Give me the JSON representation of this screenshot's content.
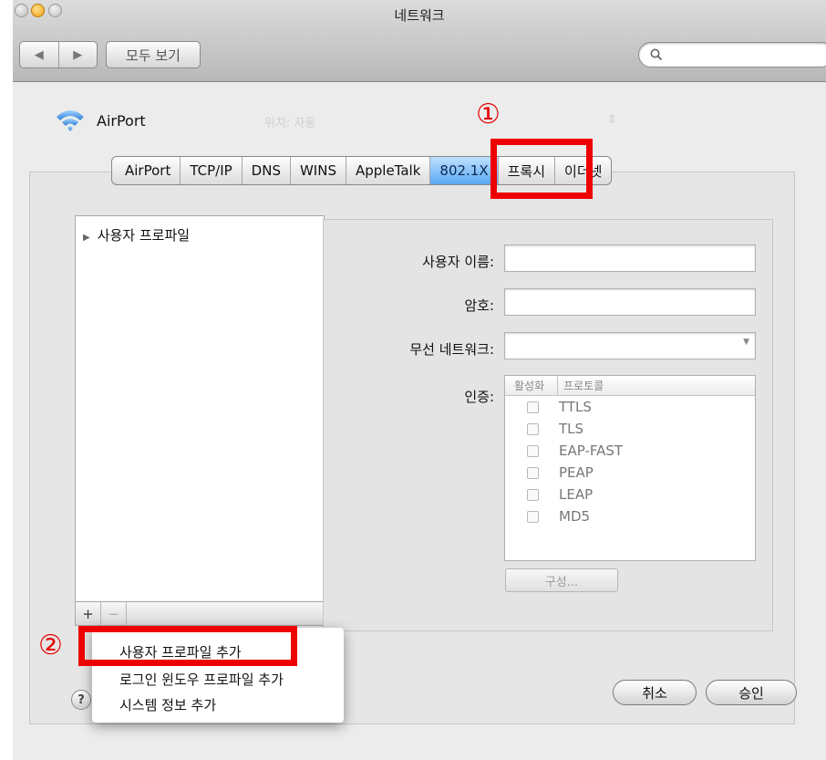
{
  "window": {
    "title": "네트워크",
    "nav_back": "◀",
    "nav_forward": "▶",
    "show_all": "모두 보기",
    "search_placeholder": ""
  },
  "header": {
    "service_name": "AirPort"
  },
  "tabs": [
    {
      "label": "AirPort",
      "active": false
    },
    {
      "label": "TCP/IP",
      "active": false
    },
    {
      "label": "DNS",
      "active": false
    },
    {
      "label": "WINS",
      "active": false
    },
    {
      "label": "AppleTalk",
      "active": false
    },
    {
      "label": "802.1X",
      "active": true
    },
    {
      "label": "프록시",
      "active": false
    },
    {
      "label": "이더넷",
      "active": false
    }
  ],
  "profile_list": {
    "items": [
      {
        "label": "사용자 프로파일",
        "expanded": false
      }
    ],
    "add_button": "+",
    "remove_button": "−"
  },
  "form": {
    "username_label": "사용자 이름:",
    "username_value": "",
    "password_label": "암호:",
    "password_value": "",
    "wireless_label": "무선 네트워크:",
    "wireless_value": "",
    "auth_label": "인증:"
  },
  "auth_table": {
    "columns": [
      "활성화",
      "프로토콜"
    ],
    "rows": [
      {
        "enabled": false,
        "protocol": "TTLS"
      },
      {
        "enabled": false,
        "protocol": "TLS"
      },
      {
        "enabled": false,
        "protocol": "EAP-FAST"
      },
      {
        "enabled": false,
        "protocol": "PEAP"
      },
      {
        "enabled": false,
        "protocol": "LEAP"
      },
      {
        "enabled": false,
        "protocol": "MD5"
      }
    ],
    "configure_button": "구성..."
  },
  "popup_menu": {
    "items": [
      "사용자 프로파일 추가",
      "로그인 윈도우 프로파일 추가",
      "시스템 정보 추가"
    ]
  },
  "buttons": {
    "cancel": "취소",
    "apply": "승인",
    "help": "?"
  },
  "annotations": {
    "marker_1": "①",
    "marker_2": "②",
    "highlight_color": "#ee0000"
  }
}
